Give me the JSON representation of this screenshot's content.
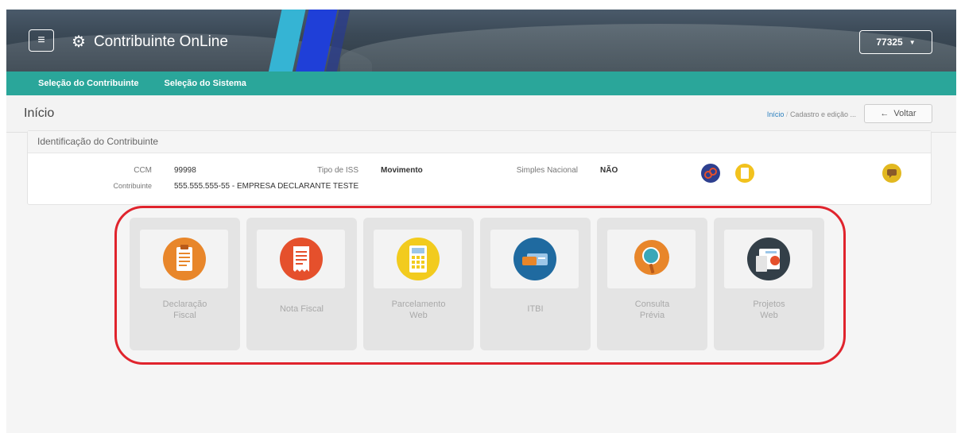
{
  "header": {
    "app_title": "Contribuinte OnLine",
    "user_code": "77325",
    "menu_icon": "hamburger-icon",
    "settings_icon": "gear-icon"
  },
  "nav": {
    "items": [
      {
        "label": "Seleção do Contribuinte"
      },
      {
        "label": "Seleção do Sistema"
      }
    ]
  },
  "page": {
    "title": "Início",
    "breadcrumb": [
      "Início",
      "Cadastro e edição ..."
    ],
    "back_label": "Voltar"
  },
  "contributor": {
    "panel_title": "Identificação do Contribuinte",
    "ccm_label": "CCM",
    "ccm_value": "99998",
    "iss_label": "Tipo de ISS",
    "iss_value": "Movimento",
    "simples_label": "Simples Nacional",
    "simples_value": "NÃO",
    "contribuinte_label": "Contribuinte",
    "contribuinte_value": "555.555.555-55 - EMPRESA DECLARANTE TESTE"
  },
  "tiles": [
    {
      "line1": "Declaração",
      "line2": "Fiscal",
      "icon": "clipboard-icon",
      "color": "#e8862a"
    },
    {
      "line1": "Nota Fiscal",
      "line2": "",
      "icon": "receipt-icon",
      "color": "#e5502c"
    },
    {
      "line1": "Parcelamento",
      "line2": "Web",
      "icon": "calculator-icon",
      "color": "#f2cb1e"
    },
    {
      "line1": "ITBI",
      "line2": "",
      "icon": "card-icon",
      "color": "#1f6aa0"
    },
    {
      "line1": "Consulta",
      "line2": "Prévia",
      "icon": "magnifier-icon",
      "color": "#e8862a"
    },
    {
      "line1": "Projetos",
      "line2": "Web",
      "icon": "web-project-icon",
      "color": "#333f48"
    }
  ],
  "colors": {
    "navbar": "#2aa69a",
    "highlight": "#e0242d",
    "accent_blue": "#1f3fd8"
  }
}
